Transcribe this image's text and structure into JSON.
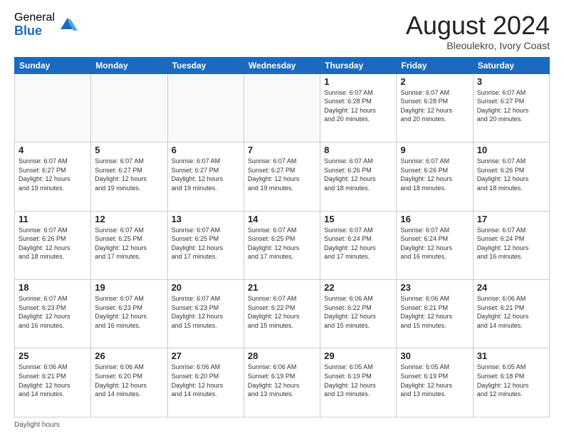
{
  "logo": {
    "general": "General",
    "blue": "Blue"
  },
  "title": "August 2024",
  "subtitle": "Bleoulekro, Ivory Coast",
  "days_of_week": [
    "Sunday",
    "Monday",
    "Tuesday",
    "Wednesday",
    "Thursday",
    "Friday",
    "Saturday"
  ],
  "footer": "Daylight hours",
  "weeks": [
    [
      {
        "day": "",
        "info": ""
      },
      {
        "day": "",
        "info": ""
      },
      {
        "day": "",
        "info": ""
      },
      {
        "day": "",
        "info": ""
      },
      {
        "day": "1",
        "info": "Sunrise: 6:07 AM\nSunset: 6:28 PM\nDaylight: 12 hours\nand 20 minutes."
      },
      {
        "day": "2",
        "info": "Sunrise: 6:07 AM\nSunset: 6:28 PM\nDaylight: 12 hours\nand 20 minutes."
      },
      {
        "day": "3",
        "info": "Sunrise: 6:07 AM\nSunset: 6:27 PM\nDaylight: 12 hours\nand 20 minutes."
      }
    ],
    [
      {
        "day": "4",
        "info": "Sunrise: 6:07 AM\nSunset: 6:27 PM\nDaylight: 12 hours\nand 19 minutes."
      },
      {
        "day": "5",
        "info": "Sunrise: 6:07 AM\nSunset: 6:27 PM\nDaylight: 12 hours\nand 19 minutes."
      },
      {
        "day": "6",
        "info": "Sunrise: 6:07 AM\nSunset: 6:27 PM\nDaylight: 12 hours\nand 19 minutes."
      },
      {
        "day": "7",
        "info": "Sunrise: 6:07 AM\nSunset: 6:27 PM\nDaylight: 12 hours\nand 19 minutes."
      },
      {
        "day": "8",
        "info": "Sunrise: 6:07 AM\nSunset: 6:26 PM\nDaylight: 12 hours\nand 18 minutes."
      },
      {
        "day": "9",
        "info": "Sunrise: 6:07 AM\nSunset: 6:26 PM\nDaylight: 12 hours\nand 18 minutes."
      },
      {
        "day": "10",
        "info": "Sunrise: 6:07 AM\nSunset: 6:26 PM\nDaylight: 12 hours\nand 18 minutes."
      }
    ],
    [
      {
        "day": "11",
        "info": "Sunrise: 6:07 AM\nSunset: 6:26 PM\nDaylight: 12 hours\nand 18 minutes."
      },
      {
        "day": "12",
        "info": "Sunrise: 6:07 AM\nSunset: 6:25 PM\nDaylight: 12 hours\nand 17 minutes."
      },
      {
        "day": "13",
        "info": "Sunrise: 6:07 AM\nSunset: 6:25 PM\nDaylight: 12 hours\nand 17 minutes."
      },
      {
        "day": "14",
        "info": "Sunrise: 6:07 AM\nSunset: 6:25 PM\nDaylight: 12 hours\nand 17 minutes."
      },
      {
        "day": "15",
        "info": "Sunrise: 6:07 AM\nSunset: 6:24 PM\nDaylight: 12 hours\nand 17 minutes."
      },
      {
        "day": "16",
        "info": "Sunrise: 6:07 AM\nSunset: 6:24 PM\nDaylight: 12 hours\nand 16 minutes."
      },
      {
        "day": "17",
        "info": "Sunrise: 6:07 AM\nSunset: 6:24 PM\nDaylight: 12 hours\nand 16 minutes."
      }
    ],
    [
      {
        "day": "18",
        "info": "Sunrise: 6:07 AM\nSunset: 6:23 PM\nDaylight: 12 hours\nand 16 minutes."
      },
      {
        "day": "19",
        "info": "Sunrise: 6:07 AM\nSunset: 6:23 PM\nDaylight: 12 hours\nand 16 minutes."
      },
      {
        "day": "20",
        "info": "Sunrise: 6:07 AM\nSunset: 6:23 PM\nDaylight: 12 hours\nand 15 minutes."
      },
      {
        "day": "21",
        "info": "Sunrise: 6:07 AM\nSunset: 6:22 PM\nDaylight: 12 hours\nand 15 minutes."
      },
      {
        "day": "22",
        "info": "Sunrise: 6:06 AM\nSunset: 6:22 PM\nDaylight: 12 hours\nand 15 minutes."
      },
      {
        "day": "23",
        "info": "Sunrise: 6:06 AM\nSunset: 6:21 PM\nDaylight: 12 hours\nand 15 minutes."
      },
      {
        "day": "24",
        "info": "Sunrise: 6:06 AM\nSunset: 6:21 PM\nDaylight: 12 hours\nand 14 minutes."
      }
    ],
    [
      {
        "day": "25",
        "info": "Sunrise: 6:06 AM\nSunset: 6:21 PM\nDaylight: 12 hours\nand 14 minutes."
      },
      {
        "day": "26",
        "info": "Sunrise: 6:06 AM\nSunset: 6:20 PM\nDaylight: 12 hours\nand 14 minutes."
      },
      {
        "day": "27",
        "info": "Sunrise: 6:06 AM\nSunset: 6:20 PM\nDaylight: 12 hours\nand 14 minutes."
      },
      {
        "day": "28",
        "info": "Sunrise: 6:06 AM\nSunset: 6:19 PM\nDaylight: 12 hours\nand 13 minutes."
      },
      {
        "day": "29",
        "info": "Sunrise: 6:05 AM\nSunset: 6:19 PM\nDaylight: 12 hours\nand 13 minutes."
      },
      {
        "day": "30",
        "info": "Sunrise: 6:05 AM\nSunset: 6:19 PM\nDaylight: 12 hours\nand 13 minutes."
      },
      {
        "day": "31",
        "info": "Sunrise: 6:05 AM\nSunset: 6:18 PM\nDaylight: 12 hours\nand 12 minutes."
      }
    ]
  ]
}
